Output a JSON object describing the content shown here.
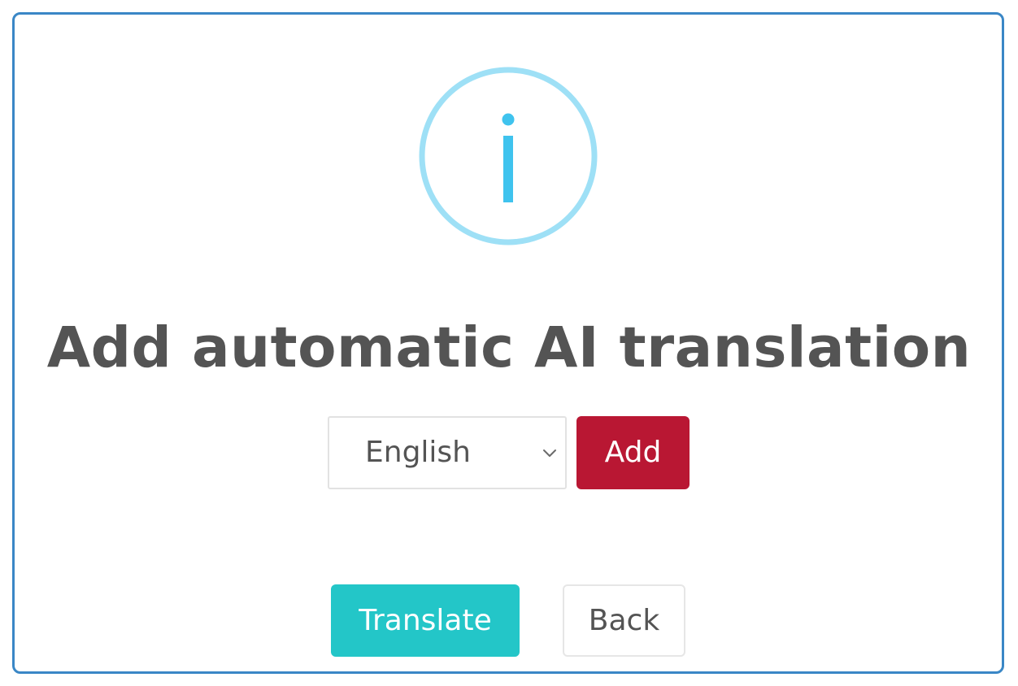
{
  "dialog": {
    "title": "Add automatic AI translation",
    "icon": "info-icon"
  },
  "language_select": {
    "selected": "English",
    "icon": "chevron-down-icon"
  },
  "buttons": {
    "add_label": "Add",
    "translate_label": "Translate",
    "back_label": "Back"
  },
  "colors": {
    "frame_border": "#3a87c6",
    "icon_ring": "#9ee0f6",
    "icon_glyph": "#3fc3ee",
    "title_text": "#545454",
    "add_button": "#b91733",
    "translate_button": "#23c6c8"
  }
}
